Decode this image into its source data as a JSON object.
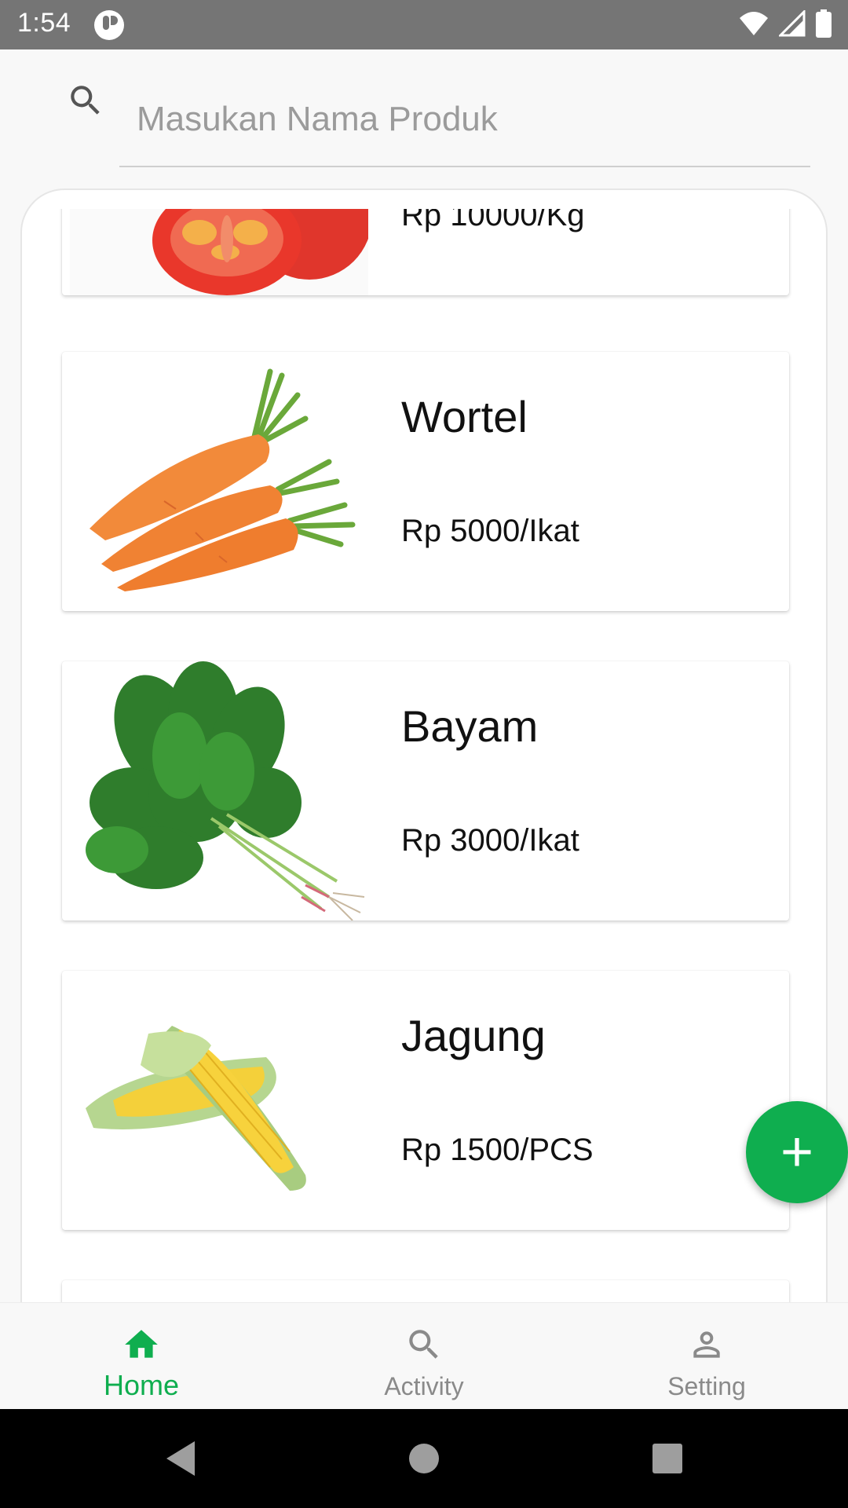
{
  "status_bar": {
    "time": "1:54"
  },
  "search": {
    "placeholder": "Masukan Nama Produk",
    "value": ""
  },
  "products": [
    {
      "name": "",
      "price": "Rp 10000/Kg",
      "image": "tomato"
    },
    {
      "name": "Wortel",
      "price": "Rp 5000/Ikat",
      "image": "carrot"
    },
    {
      "name": "Bayam",
      "price": "Rp 3000/Ikat",
      "image": "spinach"
    },
    {
      "name": "Jagung",
      "price": "Rp 1500/PCS",
      "image": "corn"
    }
  ],
  "fab": {
    "symbol": "+"
  },
  "bottom_nav": {
    "items": [
      {
        "label": "Home",
        "icon": "home-icon",
        "active": true
      },
      {
        "label": "Activity",
        "icon": "search-icon",
        "active": false
      },
      {
        "label": "Setting",
        "icon": "person-icon",
        "active": false
      }
    ]
  },
  "colors": {
    "accent": "#0fae4f",
    "inactive": "#8a8a8a"
  }
}
